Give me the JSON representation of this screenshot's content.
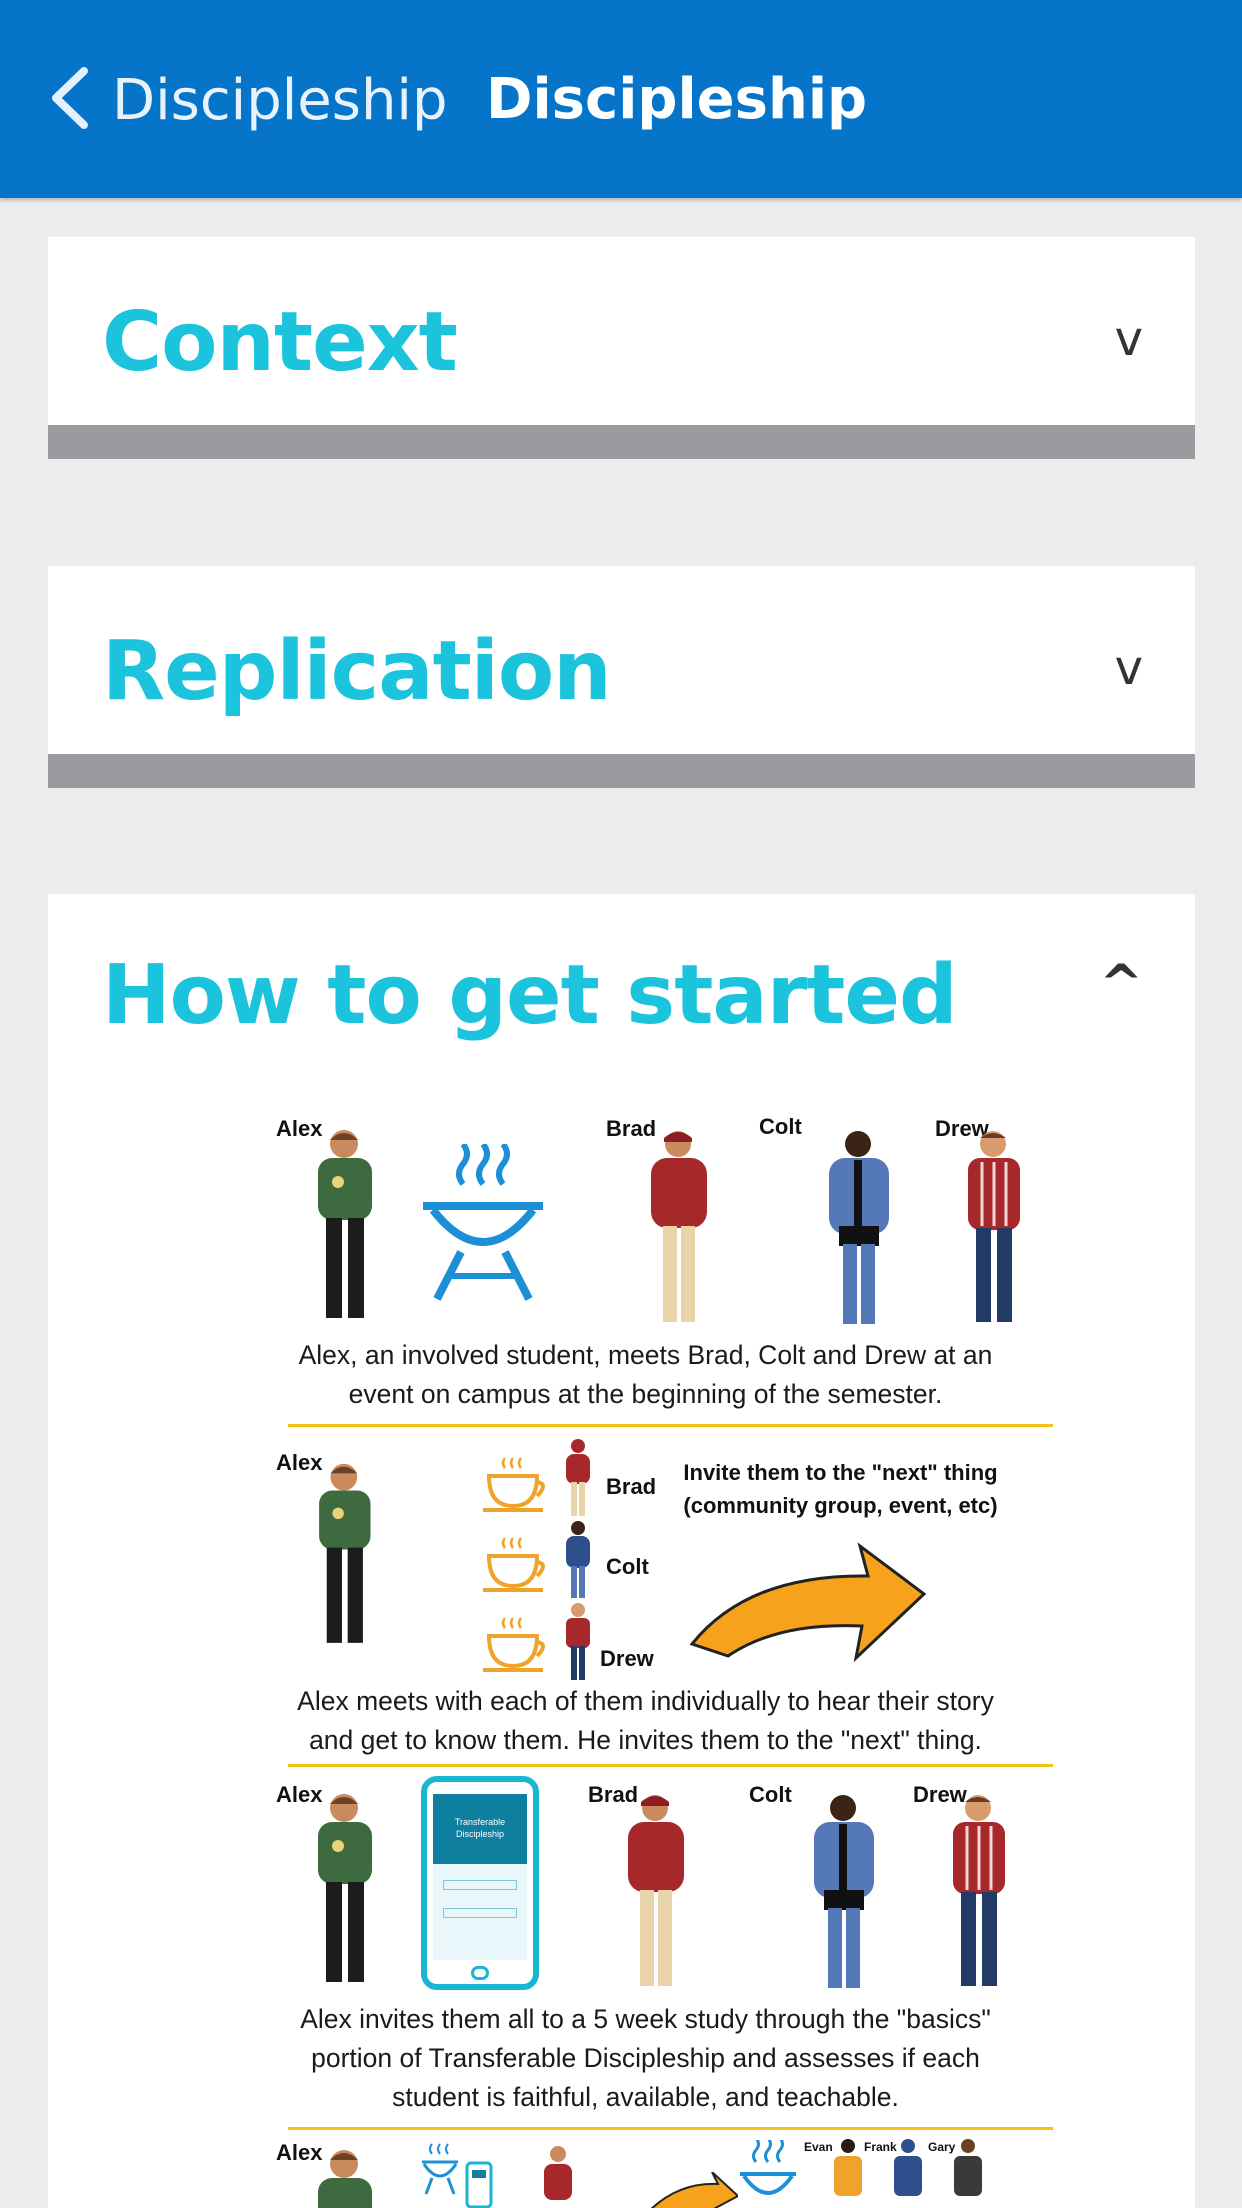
{
  "header": {
    "back_label": "Discipleship",
    "title": "Discipleship"
  },
  "sections": [
    {
      "title": "Context",
      "chevron": "v",
      "expanded": false
    },
    {
      "title": "Replication",
      "chevron": "v",
      "expanded": false
    },
    {
      "title": "How to get started",
      "chevron": "^",
      "expanded": true
    }
  ],
  "infographic": {
    "panel1": {
      "names": [
        "Alex",
        "Brad",
        "Colt",
        "Drew"
      ],
      "caption_line1": "Alex, an involved student, meets Brad, Colt and Drew at an",
      "caption_line2": "event on campus at the beginning of the semester."
    },
    "panel2": {
      "names": [
        "Alex",
        "Brad",
        "Colt",
        "Drew"
      ],
      "invite_line1": "Invite them to the \"next\" thing",
      "invite_line2": "(community group, event, etc)",
      "caption_line1": "Alex meets with each of them individually to hear their story",
      "caption_line2": "and get to know them. He invites them to the \"next\" thing."
    },
    "panel3": {
      "names": [
        "Alex",
        "Brad",
        "Colt",
        "Drew"
      ],
      "phone_text_line1": "Transferable",
      "phone_text_line2": "Discipleship",
      "caption_line1": "Alex invites them all to a 5 week study through the \"basics\"",
      "caption_line2": "portion of Transferable Discipleship and assesses if each",
      "caption_line3": "student is faithful, available, and teachable."
    },
    "panel4": {
      "names": [
        "Alex",
        "Evan",
        "Frank",
        "Gary"
      ]
    },
    "colors": {
      "green_shirt": "#3d6b3f",
      "red_jacket": "#a7282b",
      "blue_jacket": "#5578b8",
      "grill_blue": "#1d8fd6",
      "cup_orange": "#f0a32a",
      "arrow_orange": "#f6a21c",
      "phone_cyan": "#19b6d2",
      "divider_yellow": "#f2c21b"
    }
  }
}
